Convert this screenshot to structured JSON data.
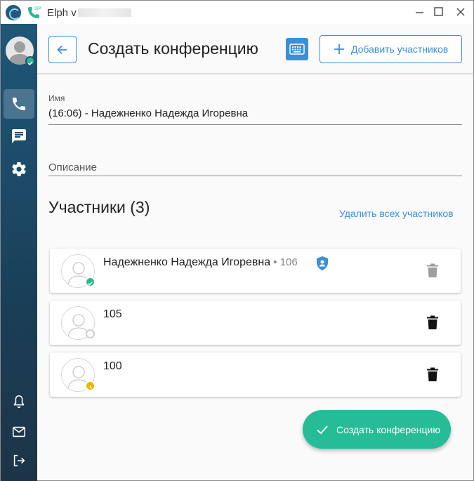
{
  "window": {
    "title": "Elph v",
    "sip_badge": "SIP"
  },
  "sidebar": {
    "items": [
      {
        "icon": "phone-icon",
        "active": true
      },
      {
        "icon": "chat-icon",
        "active": false
      },
      {
        "icon": "gear-icon",
        "active": false
      },
      {
        "icon": "bell-icon",
        "active": false
      },
      {
        "icon": "mail-icon",
        "active": false
      },
      {
        "icon": "logout-icon",
        "active": false
      }
    ],
    "user_status": "online"
  },
  "header": {
    "title": "Создать конференцию",
    "add_participants_label": "Добавить участников"
  },
  "form": {
    "name_label": "Имя",
    "name_value": "(16:06) - Надежненко Надежда Игоревна",
    "description_label": "Описание"
  },
  "participants_section": {
    "title": "Участники (3)",
    "delete_all_label": "Удалить всех участников",
    "items": [
      {
        "name": "Надежненко Надежда Игоревна",
        "separator": " • ",
        "ext": "106",
        "status": "online",
        "is_owner": true,
        "delete_enabled": false
      },
      {
        "name": "105",
        "status": "offline",
        "is_owner": false,
        "delete_enabled": true
      },
      {
        "name": "100",
        "status": "away",
        "is_owner": false,
        "delete_enabled": true
      }
    ]
  },
  "fab": {
    "label": "Создать конференцию"
  },
  "colors": {
    "accent": "#3c8fd4",
    "fab": "#26bc98",
    "online": "#29b68f",
    "away": "#f0b400",
    "sidebar": "#1f5677"
  }
}
